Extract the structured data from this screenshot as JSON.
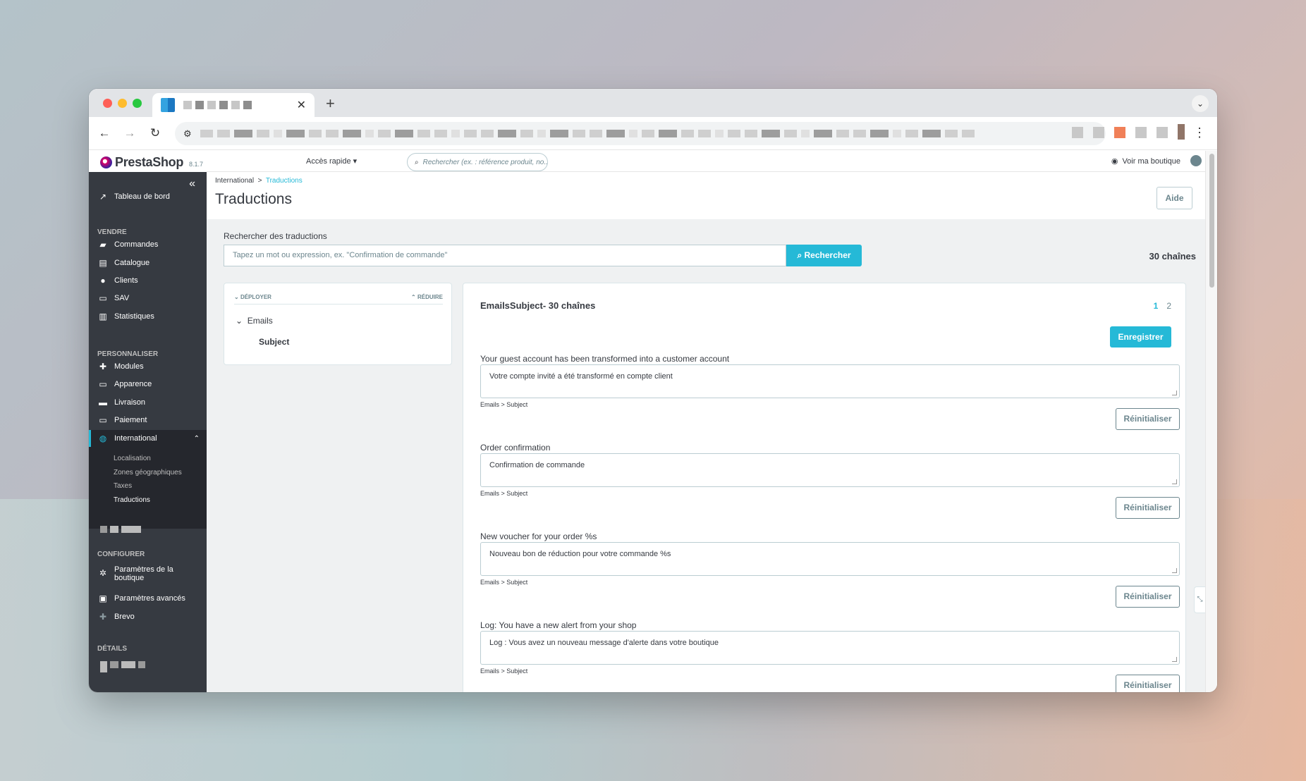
{
  "app": {
    "brand": "PrestaShop",
    "version": "8.1.7",
    "quick_access": "Accès rapide",
    "search_placeholder": "Rechercher (ex. : référence produit, no...",
    "view_shop": "Voir ma boutique"
  },
  "sidebar": {
    "dashboard": "Tableau de bord",
    "sections": {
      "sell": "VENDRE",
      "customize": "PERSONNALISER",
      "configure": "CONFIGURER",
      "details": "DÉTAILS"
    },
    "sell_items": [
      "Commandes",
      "Catalogue",
      "Clients",
      "SAV",
      "Statistiques"
    ],
    "customize_items": [
      "Modules",
      "Apparence",
      "Livraison",
      "Paiement"
    ],
    "international": "International",
    "international_sub": [
      "Localisation",
      "Zones géographiques",
      "Taxes",
      "Traductions"
    ],
    "configure_items": [
      "Paramètres de la boutique",
      "Paramètres avancés",
      "Brevo"
    ]
  },
  "page": {
    "breadcrumb_parent": "International",
    "breadcrumb_sep": ">",
    "breadcrumb_current": "Traductions",
    "title": "Traductions",
    "help_label": "Aide"
  },
  "search": {
    "label": "Rechercher des traductions",
    "placeholder": "Tapez un mot ou expression, ex. \"Confirmation de commande\"",
    "button": "Rechercher",
    "count": "30 chaînes"
  },
  "tree": {
    "expand": "DÉPLOYER",
    "reduce": "RÉDUIRE",
    "domain": "Emails",
    "subdomain": "Subject"
  },
  "translations": {
    "title": "EmailsSubject- 30 chaînes",
    "pages": [
      "1",
      "2"
    ],
    "save_label": "Enregistrer",
    "reset_label": "Réinitialiser",
    "items": [
      {
        "source": "Your guest account has been transformed into a customer account",
        "translation": "Votre compte invité a été transformé en compte client",
        "path": "Emails > Subject"
      },
      {
        "source": "Order confirmation",
        "translation": "Confirmation de commande",
        "path": "Emails > Subject"
      },
      {
        "source": "New voucher for your order %s",
        "translation": "Nouveau bon de réduction pour votre commande %s",
        "path": "Emails > Subject"
      },
      {
        "source": "Log: You have a new alert from your shop",
        "translation": "Log : Vous avez un nouveau message d'alerte dans votre boutique",
        "path": "Emails > Subject"
      }
    ]
  },
  "colors": {
    "accent": "#25b9d7",
    "sidebar": "#363a41",
    "text": "#363a41"
  }
}
